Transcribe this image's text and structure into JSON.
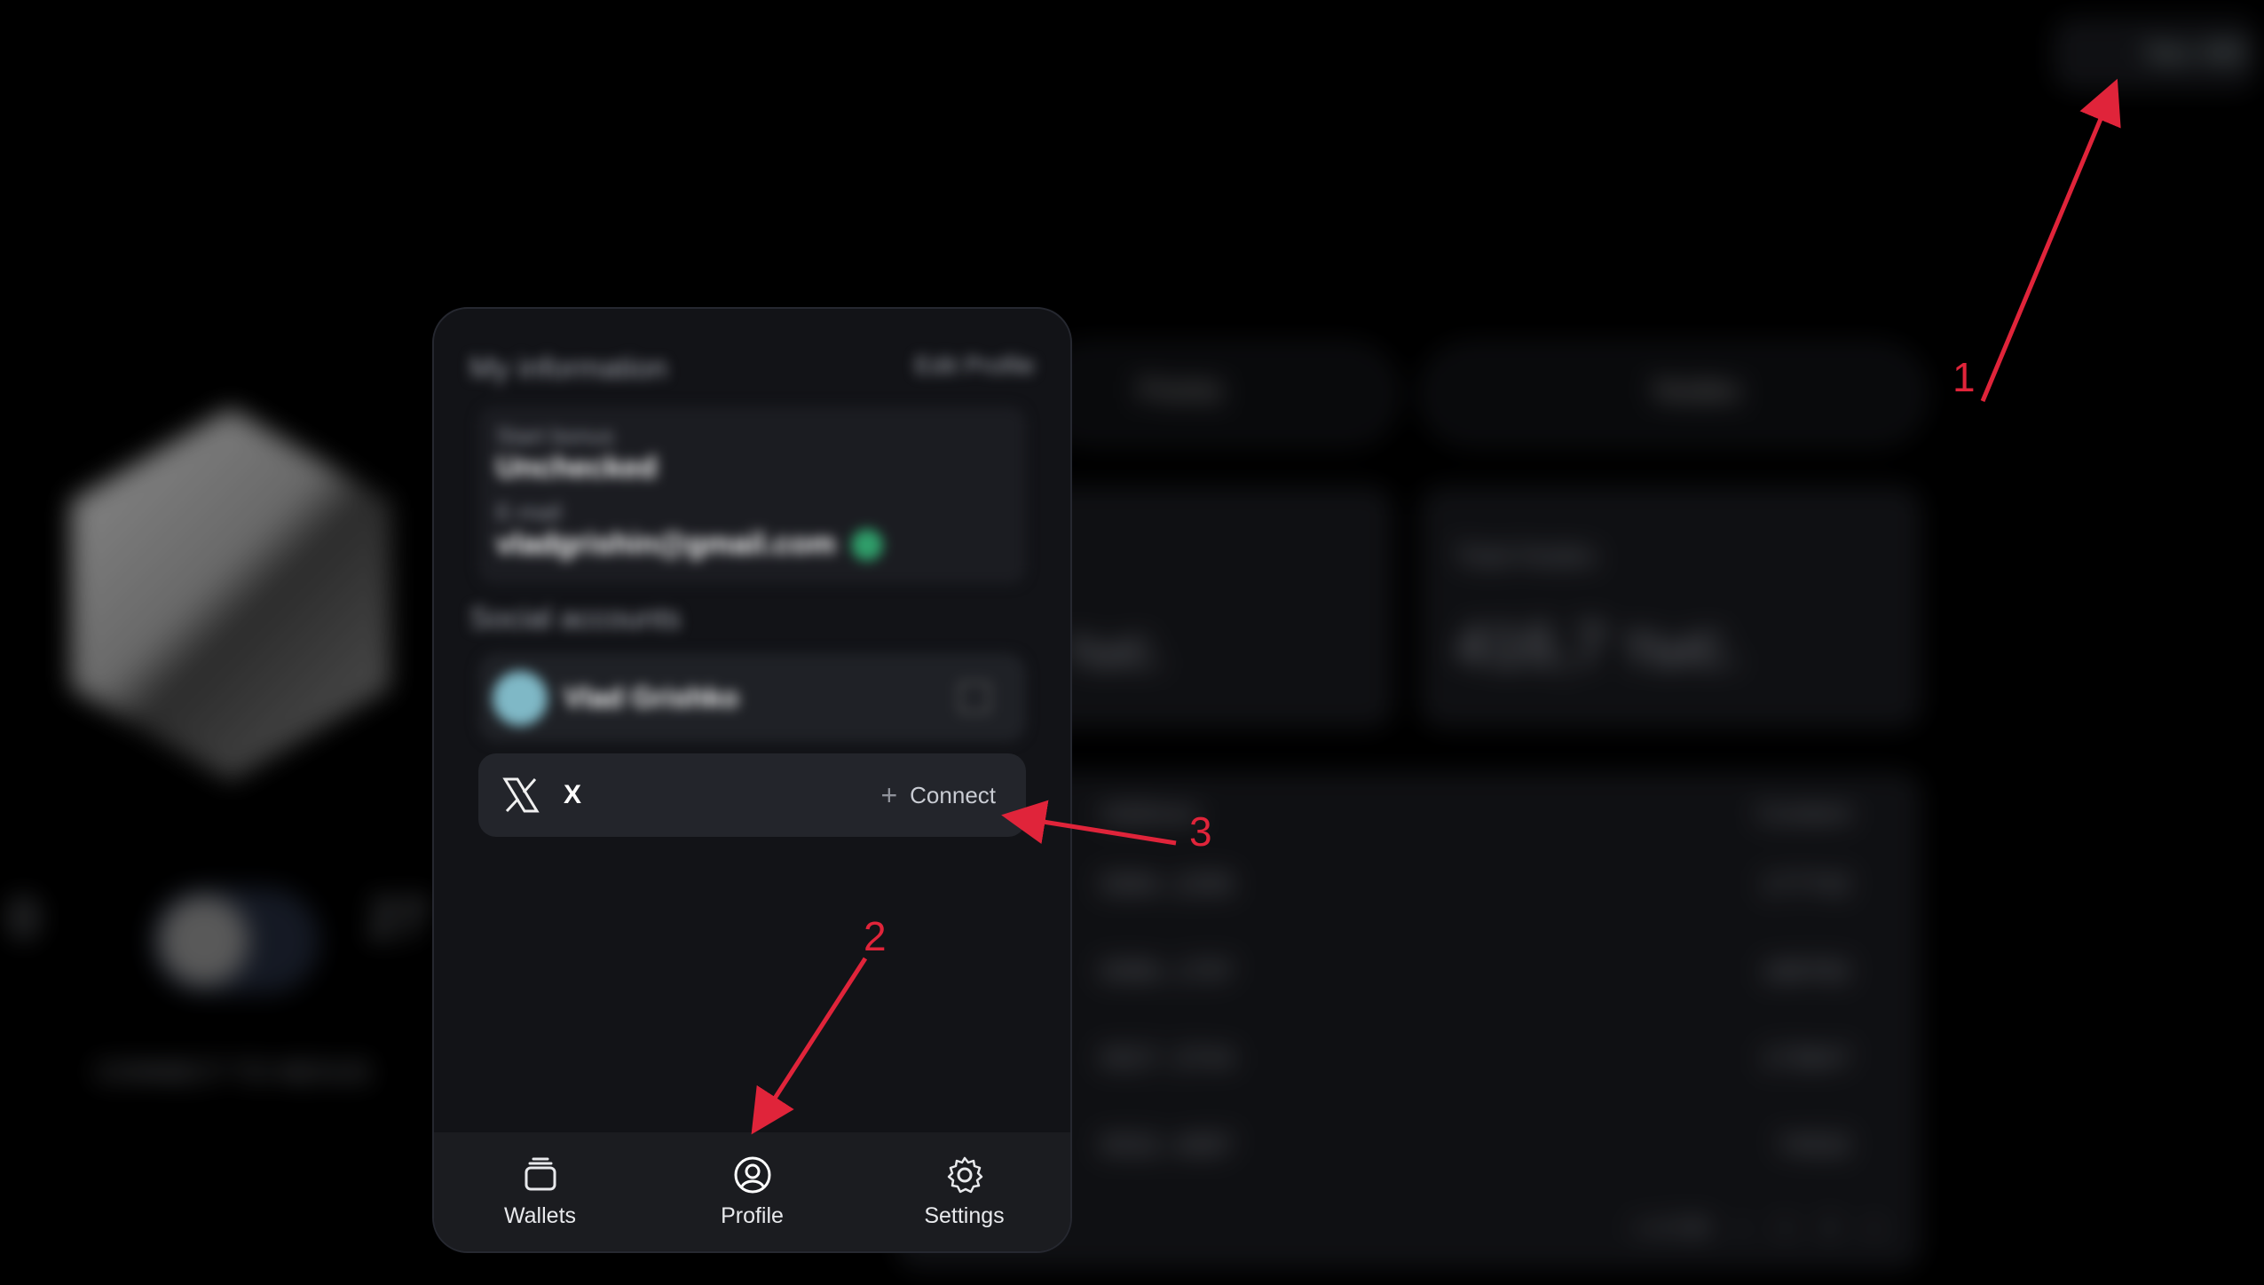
{
  "background": {
    "wallet_pill": "Nex 460",
    "buttons": [
      "Points",
      "Nodes"
    ],
    "stats": [
      {
        "label": "",
        "value": "тыс."
      },
      {
        "label": "Total Nodes",
        "value": "416,7 тыс."
      }
    ],
    "left": {
      "counts": [
        "0",
        "27"
      ],
      "connect_label": "CONNECT TO NEXUS"
    },
    "table": {
      "headers": [
        "Address",
        "Content"
      ],
      "rows": [
        [
          "0084..2295",
          "177742"
        ],
        [
          "0096..1797",
          "189782"
        ],
        [
          "0527..3744",
          "173647"
        ],
        [
          "0532..4087",
          "74532"
        ]
      ],
      "pagination": [
        "1 of 268",
        "‹",
        "1",
        "2",
        "»"
      ]
    }
  },
  "modal": {
    "title": "My information",
    "edit_label": "Edit Profile",
    "info": {
      "status_label": "Start bonus",
      "status_value": "Unchecked",
      "email_label": "E-mail",
      "email_value": "vladgrishin@gmail.com"
    },
    "social_label": "Social accounts",
    "social_user": "Vlad Grishko",
    "x": {
      "name": "X",
      "connect_label": "Connect"
    },
    "nav": [
      {
        "label": "Wallets"
      },
      {
        "label": "Profile"
      },
      {
        "label": "Settings"
      }
    ]
  },
  "annotations": {
    "one": "1",
    "two": "2",
    "three": "3"
  },
  "colors": {
    "annotation": "#e0243a",
    "background": "#000000",
    "modal": "#121317"
  }
}
